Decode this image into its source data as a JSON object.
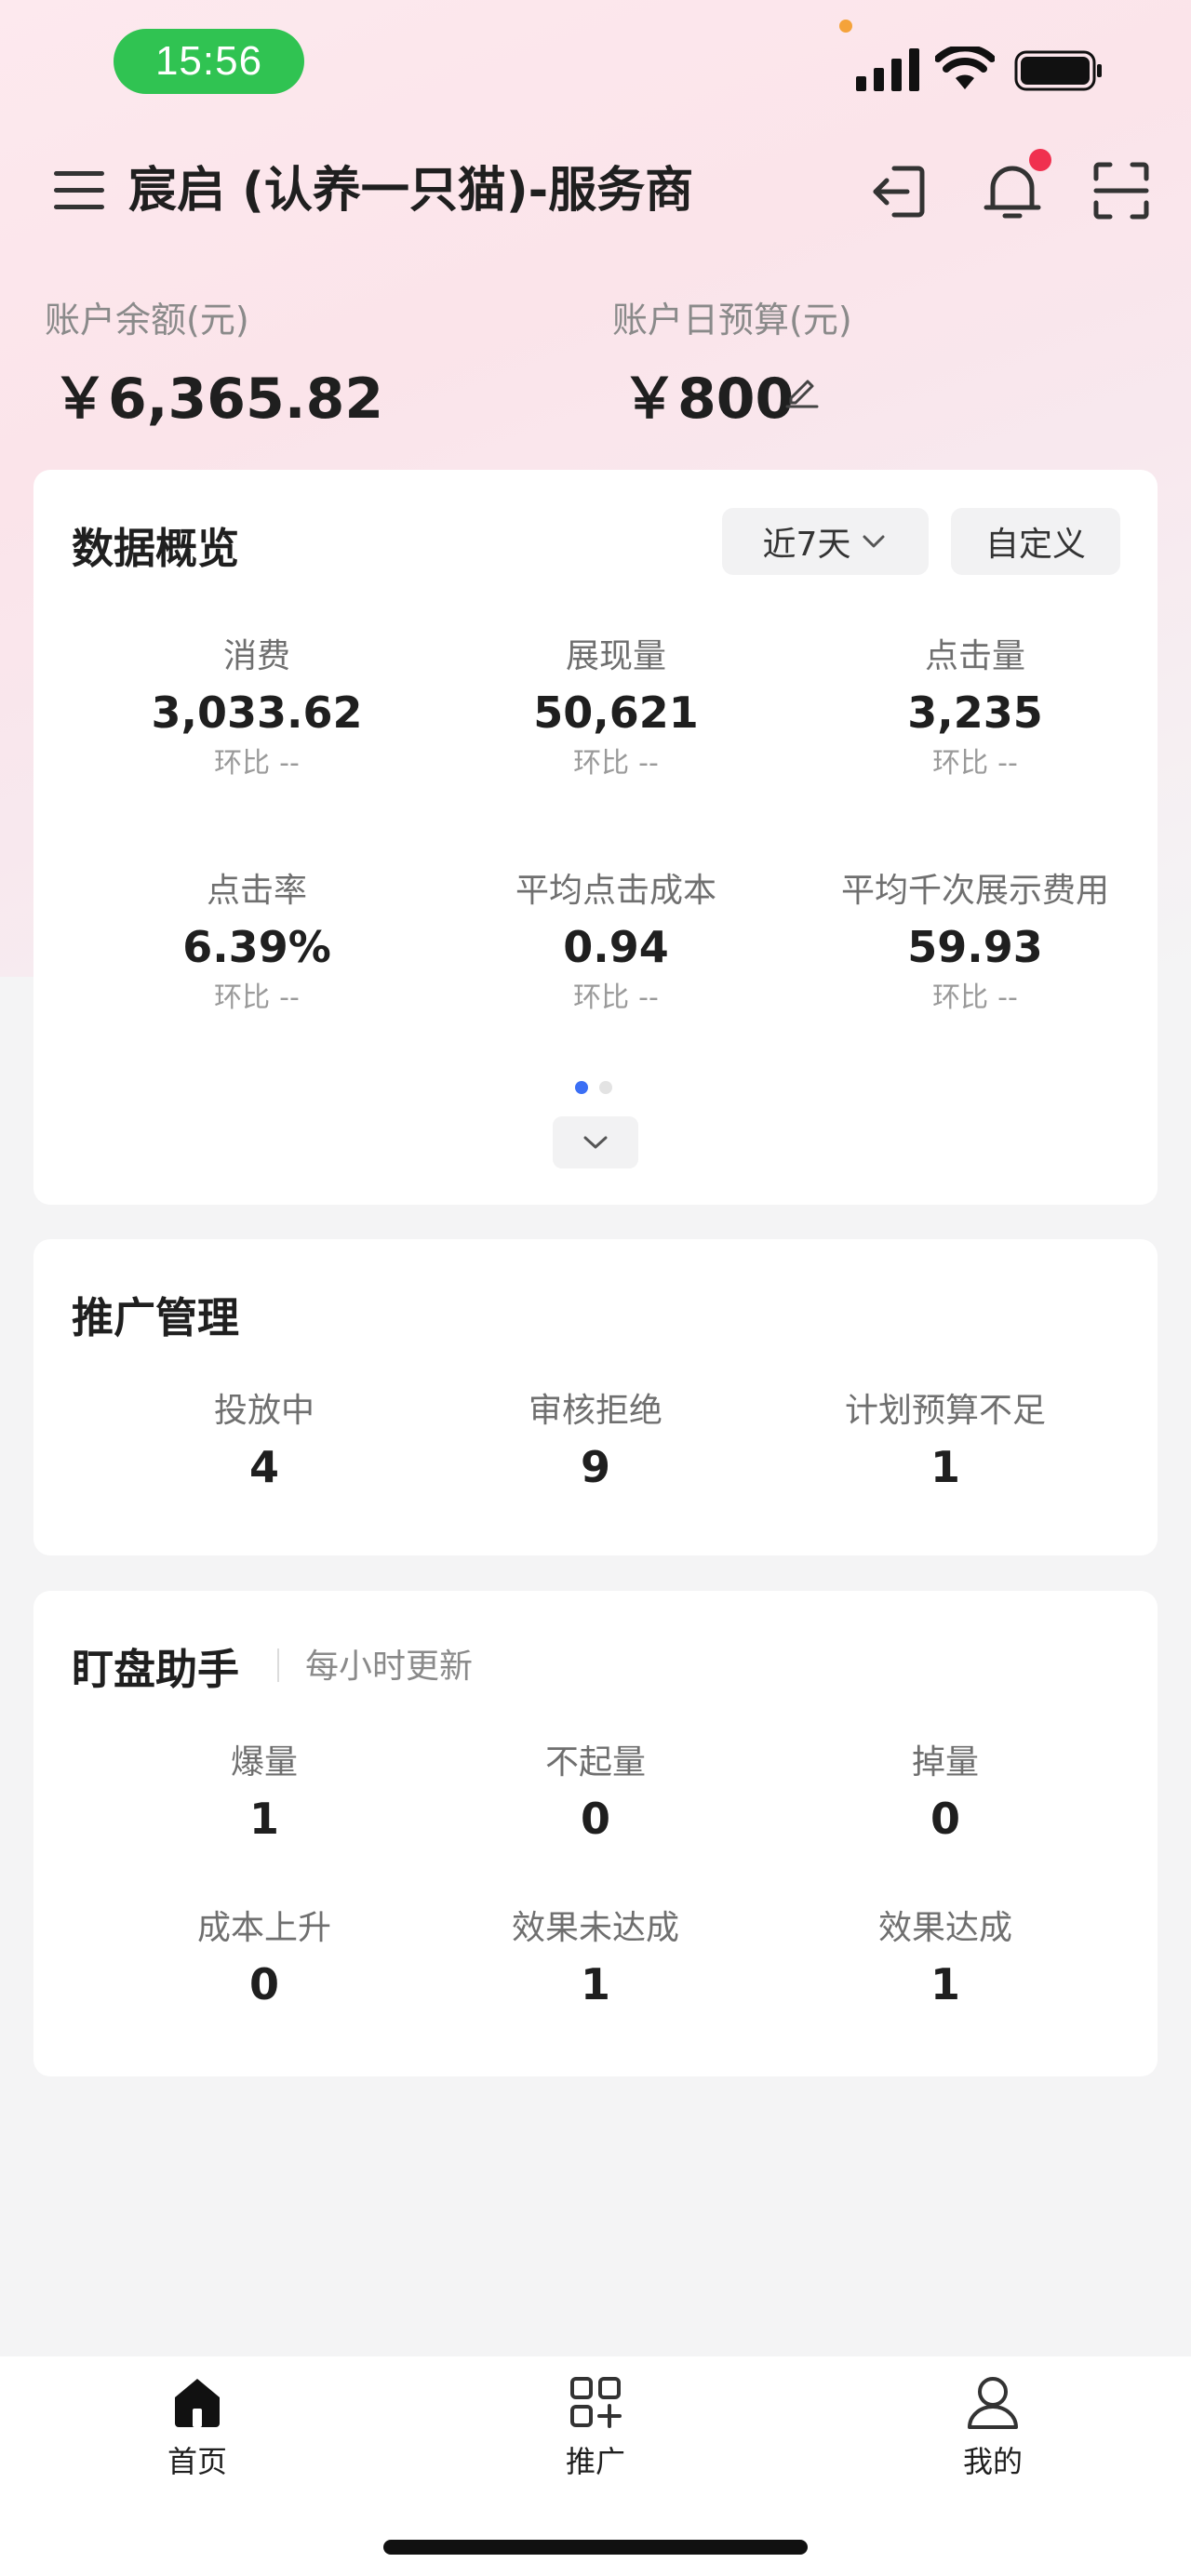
{
  "status_bar": {
    "time": "15:56"
  },
  "header": {
    "title": "宸启 (认养一只猫)-服务商"
  },
  "balance": {
    "account_balance_label": "账户余额(元)",
    "account_balance_value": "￥6,365.82",
    "daily_budget_label": "账户日预算(元)",
    "daily_budget_value": "￥800"
  },
  "overview": {
    "title": "数据概览",
    "range_label": "近7天",
    "custom_label": "自定义",
    "ratio_label": "环比",
    "metrics": [
      {
        "label": "消费",
        "value": "3,033.62",
        "ratio": "--"
      },
      {
        "label": "展现量",
        "value": "50,621",
        "ratio": "--"
      },
      {
        "label": "点击量",
        "value": "3,235",
        "ratio": "--"
      },
      {
        "label": "点击率",
        "value": "6.39%",
        "ratio": "--"
      },
      {
        "label": "平均点击成本",
        "value": "0.94",
        "ratio": "--"
      },
      {
        "label": "平均千次展示费用",
        "value": "59.93",
        "ratio": "--"
      }
    ],
    "pager": {
      "pages": 2,
      "current": 1
    }
  },
  "promotion": {
    "title": "推广管理",
    "stats": [
      {
        "label": "投放中",
        "value": "4"
      },
      {
        "label": "审核拒绝",
        "value": "9"
      },
      {
        "label": "计划预算不足",
        "value": "1"
      }
    ]
  },
  "monitor": {
    "title": "盯盘助手",
    "subtitle": "每小时更新",
    "stats": [
      {
        "label": "爆量",
        "value": "1"
      },
      {
        "label": "不起量",
        "value": "0"
      },
      {
        "label": "掉量",
        "value": "0"
      },
      {
        "label": "成本上升",
        "value": "0"
      },
      {
        "label": "效果未达成",
        "value": "1"
      },
      {
        "label": "效果达成",
        "value": "1"
      }
    ]
  },
  "bottom_nav": [
    {
      "label": "首页",
      "icon": "home-icon"
    },
    {
      "label": "推广",
      "icon": "grid-plus-icon"
    },
    {
      "label": "我的",
      "icon": "user-icon"
    }
  ],
  "colors": {
    "accent_blue": "#3b6ff5",
    "status_green": "#30c352",
    "notification_red": "#f0304f"
  }
}
